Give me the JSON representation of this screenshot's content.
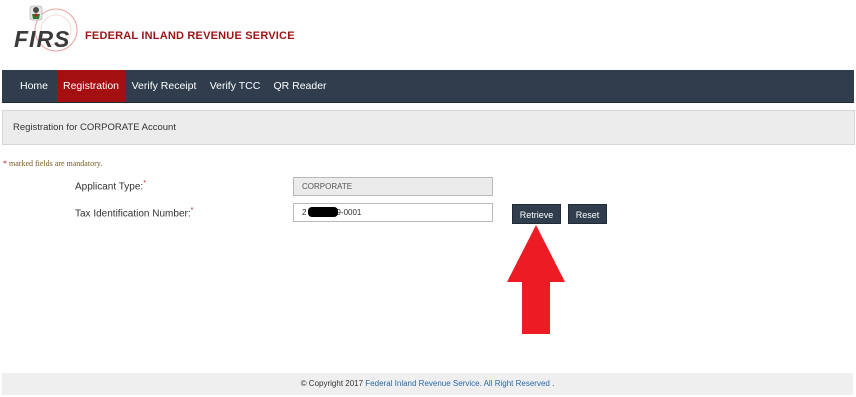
{
  "header": {
    "logo_text": "FIRS",
    "logo_ring_text": "FEDERAL INLAND REVENUE SERVICE",
    "site_title": "FEDERAL INLAND REVENUE SERVICE"
  },
  "nav": {
    "items": [
      {
        "label": "Home",
        "active": false
      },
      {
        "label": "Registration",
        "active": true
      },
      {
        "label": "Verify Receipt",
        "active": false
      },
      {
        "label": "Verify TCC",
        "active": false
      },
      {
        "label": "QR Reader",
        "active": false
      }
    ]
  },
  "panel": {
    "title": "Registration for CORPORATE Account"
  },
  "form": {
    "mandatory_note_star": "*",
    "mandatory_note_text": " marked fields are mandatory.",
    "applicant_type_label": "Applicant Type:",
    "applicant_type_value": "CORPORATE",
    "tin_label": "Tax Identification Number:",
    "tin_value_prefix": "2",
    "tin_value_suffix": "9-0001",
    "required_mark": "*"
  },
  "buttons": {
    "retrieve": "Retrieve",
    "reset": "Reset"
  },
  "annotation": {
    "arrow_color": "#ed1c24"
  },
  "footer": {
    "copyright": "© Copyright 2017 ",
    "org_link": "Federal Inland Revenue Service. All Right Reserved",
    "end": " ."
  },
  "colors": {
    "nav_bg": "#2f3d4d",
    "nav_active": "#a40f12",
    "title_red": "#9b1518"
  }
}
